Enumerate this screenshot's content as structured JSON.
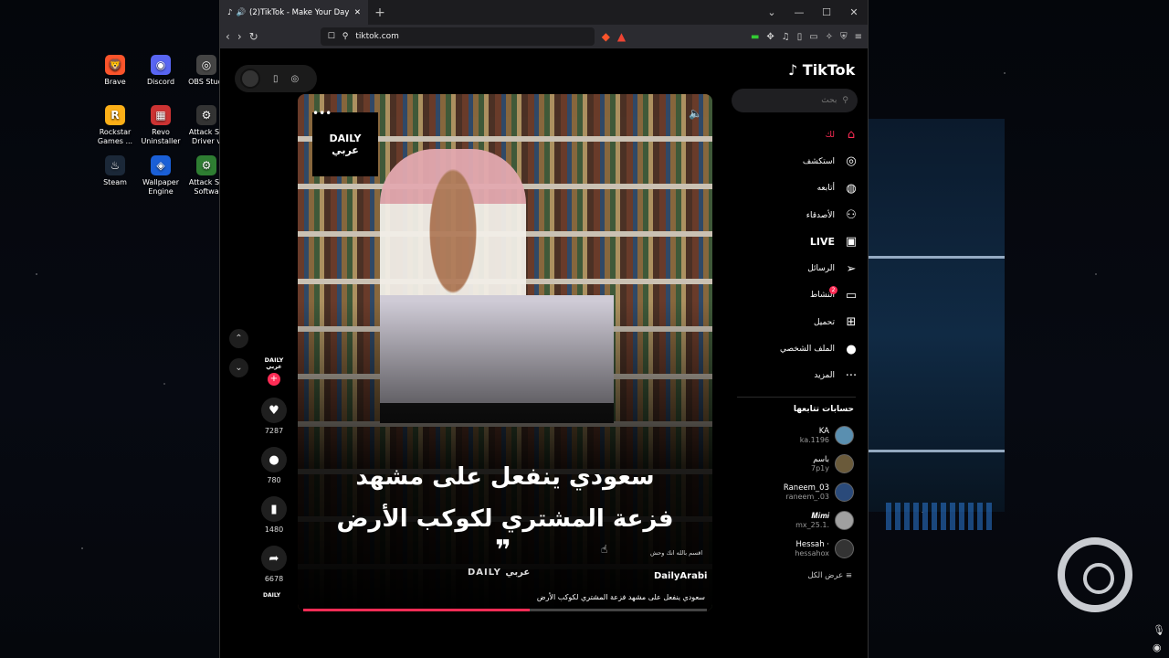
{
  "desktop": {
    "icons": [
      {
        "label": "Brave",
        "glyph": "🦁",
        "color": "#fb542b"
      },
      {
        "label": "Discord",
        "glyph": "◉",
        "color": "#5865f2"
      },
      {
        "label": "OBS Studi",
        "glyph": "◎",
        "color": "#444"
      },
      {
        "label": "Rockstar Games ...",
        "glyph": "R",
        "color": "#fcaf17"
      },
      {
        "label": "Revo Uninstaller",
        "glyph": "▦",
        "color": "#c33"
      },
      {
        "label": "Attack Sh Driver v",
        "glyph": "⚙",
        "color": "#333"
      },
      {
        "label": "Steam",
        "glyph": "♨",
        "color": "#1b2838"
      },
      {
        "label": "Wallpaper Engine",
        "glyph": "◈",
        "color": "#1a5fd6"
      },
      {
        "label": "Attack Sh Softwa",
        "glyph": "⚙",
        "color": "#2e7d32"
      }
    ]
  },
  "browser": {
    "tab_title": "(2)TikTok - Make Your Day",
    "url": "tiktok.com"
  },
  "tiktok": {
    "logo": "TikTok",
    "search_placeholder": "بحث",
    "nav": [
      {
        "label": "لك",
        "icon": "⌂",
        "active": true
      },
      {
        "label": "استكشف",
        "icon": "◎"
      },
      {
        "label": "أتابعه",
        "icon": "◍"
      },
      {
        "label": "الأصدقاء",
        "icon": "⚇"
      },
      {
        "label": "LIVE",
        "icon": "▣",
        "live": true
      },
      {
        "label": "الرسائل",
        "icon": "➢"
      },
      {
        "label": "النشاط",
        "icon": "▭",
        "badge": "2"
      },
      {
        "label": "تحميل",
        "icon": "⊞"
      },
      {
        "label": "الملف الشخصي",
        "icon": "●"
      },
      {
        "label": "المزيد",
        "icon": "···"
      }
    ],
    "following_title": "حسابات تتابعها",
    "accounts": [
      {
        "name": "KA",
        "handle": "ka.1196"
      },
      {
        "name": "باسم",
        "handle": "7p1y"
      },
      {
        "name": "Raneem_03",
        "handle": "raneem_.03"
      },
      {
        "name": "𝑴𝒊𝒎𝒊",
        "handle": "mx_25.1."
      },
      {
        "name": "Hessah ·",
        "handle": "hessahox"
      }
    ],
    "see_all": "عرض الكل",
    "video": {
      "brand_top": "DAILY",
      "brand_bottom": "عربي",
      "caption_line1": "سعودي ينفعل على مشهد",
      "caption_line2": "فزعة المشتري لكوكب الأرض",
      "quote_mark": "❞",
      "watermark": "DAILY عربي",
      "oath_text": "اقسم بالله انك وحش",
      "author": "DailyArabi",
      "description": "سعودي ينفعل على مشهد فزعة المشتري لكوكب الأرض",
      "progress": 0.56
    },
    "actions": {
      "creator": "DAILY عربي",
      "likes": "7287",
      "comments": "780",
      "saves": "1480",
      "shares": "6678"
    }
  }
}
